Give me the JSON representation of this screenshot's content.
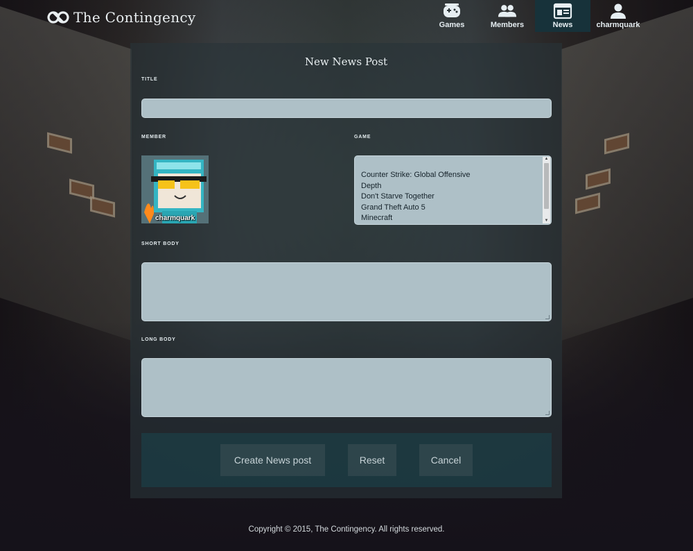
{
  "app": {
    "title": "The Contingency"
  },
  "nav": {
    "items": [
      {
        "label": "Games",
        "icon": "gamepad-icon",
        "active": false
      },
      {
        "label": "Members",
        "icon": "members-icon",
        "active": false
      },
      {
        "label": "News",
        "icon": "news-icon",
        "active": true
      },
      {
        "label": "charmquark",
        "icon": "user-icon",
        "active": false
      }
    ]
  },
  "form": {
    "title": "New News Post",
    "labels": {
      "title": "TITLE",
      "member": "MEMBER",
      "game": "GAME",
      "short_body": "SHORT BODY",
      "long_body": "LONG BODY"
    },
    "values": {
      "title": "",
      "short_body": "",
      "long_body": ""
    },
    "member": {
      "name": "charmquark"
    },
    "game_options": [
      "Counter Strike: Global Offensive",
      "Depth",
      "Don't Starve Together",
      "Grand Theft Auto 5",
      "Minecraft"
    ],
    "buttons": {
      "create": "Create News post",
      "reset": "Reset",
      "cancel": "Cancel"
    }
  },
  "footer": {
    "copyright": "Copyright © 2015, The Contingency. All rights reserved."
  },
  "colors": {
    "accent": "#17323a",
    "field_bg": "#aec0c7",
    "panel_bg": "#283438",
    "button_bar": "#19464e"
  }
}
